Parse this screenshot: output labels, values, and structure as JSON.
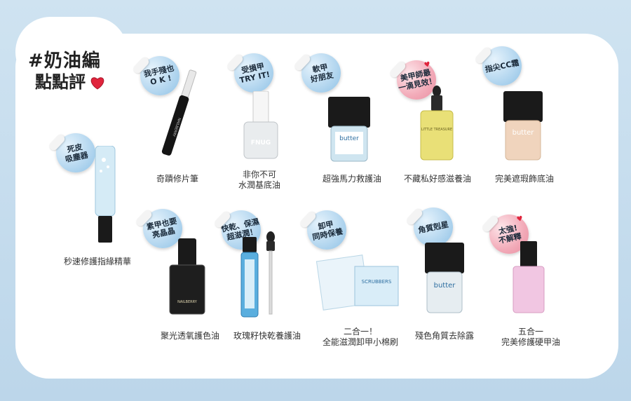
{
  "title": {
    "line1": "#奶油編",
    "line2": "點點評"
  },
  "products": [
    {
      "id": "pen",
      "sticker": "我手殘也\nO K !",
      "label": "奇蹟修片筆"
    },
    {
      "id": "base",
      "sticker": "受損甲\nTRY IT!",
      "label": "非你不可\n水潤基底油",
      "bottle_text": "FNUG"
    },
    {
      "id": "rescue",
      "sticker": "軟甲\n好朋友",
      "label": "超強馬力救護油",
      "bottle_text": "butter"
    },
    {
      "id": "oil",
      "sticker": "美甲師最\n一滴見效！",
      "label": "不藏私好感滋養油",
      "bottle_text": "LITTLE TREASURE"
    },
    {
      "id": "cc",
      "sticker": "指尖CC霜",
      "label": "完美遮瑕飾底油",
      "bottle_text": "butter"
    },
    {
      "id": "cuticle",
      "sticker": "死皮\n吸塵器",
      "label": "秒速修護指緣精華"
    },
    {
      "id": "topcoat",
      "sticker": "素甲也要\n亮晶晶",
      "label": "聚光透氧護色油",
      "bottle_text": "NAILBERRY"
    },
    {
      "id": "rose",
      "sticker": "快乾、保濕\n超滋潤！",
      "label": "玫瑰籽快乾養護油"
    },
    {
      "id": "pads",
      "sticker": "卸甲\n同時保養",
      "label": "二合一！\n全能滋潤卸甲小棉刷",
      "bottle_text": "SCRUBBERS"
    },
    {
      "id": "exfol",
      "sticker": "角質剋星",
      "label": "殘色角質去除露",
      "bottle_text": "butter"
    },
    {
      "id": "harden",
      "sticker": "太強!\n不解釋",
      "label": "五合一\n完美修護硬甲油"
    }
  ],
  "colors": {
    "bg": "#c7dded",
    "sticker_blue": "#b3d6ef",
    "sticker_pink": "#f2aab8",
    "heart": "#e0243c"
  }
}
